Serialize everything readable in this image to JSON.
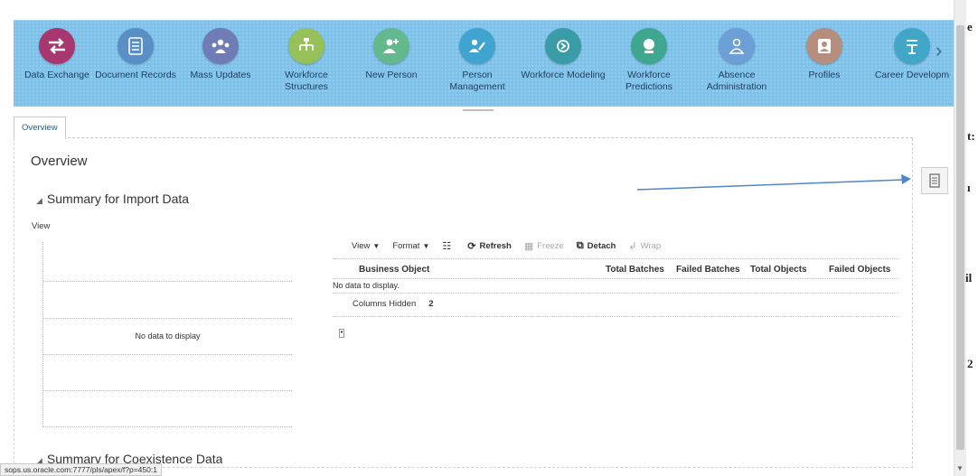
{
  "launcher": {
    "apps": [
      {
        "label": "Data Exchange",
        "icon": "exchange-arrows-icon",
        "color": "#a8376f"
      },
      {
        "label": "Document Records",
        "icon": "document-records-icon",
        "color": "#5a8fc6"
      },
      {
        "label": "Mass Updates",
        "icon": "people-group-icon",
        "color": "#6f7cb5"
      },
      {
        "label": "Workforce Structures",
        "icon": "structure-icon",
        "color": "#96c05a"
      },
      {
        "label": "New Person",
        "icon": "add-person-icon",
        "color": "#63b88e"
      },
      {
        "label": "Person Management",
        "icon": "person-edit-icon",
        "color": "#3fa4cf"
      },
      {
        "label": "Workforce Modeling",
        "icon": "modeling-icon",
        "color": "#3a9ca6"
      },
      {
        "label": "Workforce Predictions",
        "icon": "predictions-icon",
        "color": "#3fa78f"
      },
      {
        "label": "Absence Administration",
        "icon": "absence-icon",
        "color": "#6b9fd6"
      },
      {
        "label": "Profiles",
        "icon": "profile-icon",
        "color": "#b58e7d"
      },
      {
        "label": "Career Developm",
        "icon": "career-icon",
        "color": "#41a6c8"
      }
    ]
  },
  "tabs": [
    {
      "label": "Overview"
    }
  ],
  "page": {
    "title": "Overview",
    "section1_title": "Summary for Import Data",
    "section2_title": "Summary for Coexistence Data",
    "view_label": "View",
    "chart_empty_message": "No data to display"
  },
  "toolbar": {
    "view": "View",
    "format": "Format",
    "refresh": "Refresh",
    "freeze": "Freeze",
    "detach": "Detach",
    "wrap": "Wrap"
  },
  "table": {
    "columns": [
      "Business Object",
      "Total Batches",
      "Failed Batches",
      "Total Objects",
      "Failed Objects"
    ],
    "no_data": "No data to display.",
    "columns_hidden_label": "Columns Hidden",
    "columns_hidden_count": "2"
  },
  "status_bar": {
    "url": "sops.us.oracle.com:7777/pls/apex/f?p=450:1"
  },
  "right_fragments": [
    "e",
    "t:",
    "ı",
    "il",
    "2"
  ]
}
